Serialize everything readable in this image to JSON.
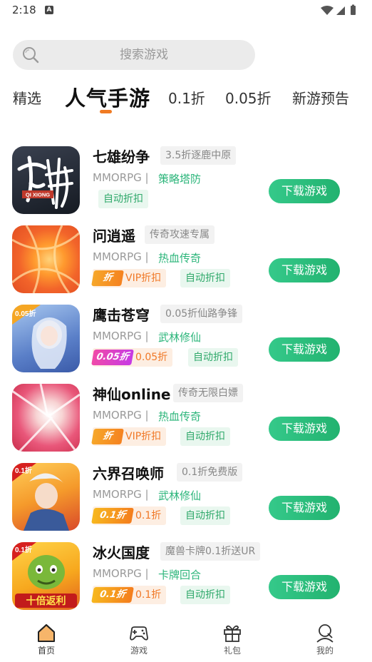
{
  "status_bar": {
    "time": "2:18",
    "notification_icon": "A"
  },
  "search": {
    "placeholder": "搜索游戏"
  },
  "tabs": [
    {
      "label": "精选"
    },
    {
      "label": "人气手游",
      "active": true
    },
    {
      "label": "0.1折"
    },
    {
      "label": "0.05折"
    },
    {
      "label": "新游预告"
    }
  ],
  "accent_color": "#f07b23",
  "games": [
    {
      "name": "七雄纷争",
      "tagline": "3.5折逐鹿中原",
      "genre": "MMORPG |",
      "category": "策略塔防",
      "discount_tag": null,
      "auto_label": "自动折扣",
      "download_label": "下载游戏",
      "icon_text": "七雄 QI XIONG"
    },
    {
      "name": "问逍遥",
      "tagline": "传奇攻速专属",
      "genre": "MMORPG |",
      "category": "热血传奇",
      "discount_tag": {
        "badge": "折",
        "label": "VIP折扣"
      },
      "auto_label": "自动折扣",
      "download_label": "下载游戏",
      "icon_text": ""
    },
    {
      "name": "鹰击苍穹",
      "tagline": "0.05折仙路争锋",
      "genre": "MMORPG |",
      "category": "武林修仙",
      "discount_tag": {
        "badge": "0.05折",
        "label": "0.05折"
      },
      "auto_label": "自动折扣",
      "download_label": "下载游戏",
      "icon_text": "0.05折"
    },
    {
      "name": "神仙online",
      "tagline": "传奇无限白嫖",
      "genre": "MMORPG |",
      "category": "热血传奇",
      "discount_tag": {
        "badge": "折",
        "label": "VIP折扣"
      },
      "auto_label": "自动折扣",
      "download_label": "下载游戏",
      "icon_text": ""
    },
    {
      "name": "六界召唤师",
      "tagline": "0.1折免费版",
      "genre": "MMORPG |",
      "category": "武林修仙",
      "discount_tag": {
        "badge": "0.1折",
        "label": "0.1折"
      },
      "auto_label": "自动折扣",
      "download_label": "下载游戏",
      "icon_text": "0.1折"
    },
    {
      "name": "冰火国度",
      "tagline": "魔兽卡牌0.1折送UR",
      "genre": "MMORPG |",
      "category": "卡牌回合",
      "discount_tag": {
        "badge": "0.1折",
        "label": "0.1折"
      },
      "auto_label": "自动折扣",
      "download_label": "下载游戏",
      "icon_text": "0.1折 十倍返利"
    }
  ],
  "bottom_nav": [
    {
      "label": "首页",
      "icon": "home-icon",
      "active": true
    },
    {
      "label": "游戏",
      "icon": "gamepad-icon"
    },
    {
      "label": "礼包",
      "icon": "gift-icon"
    },
    {
      "label": "我的",
      "icon": "profile-icon"
    }
  ]
}
